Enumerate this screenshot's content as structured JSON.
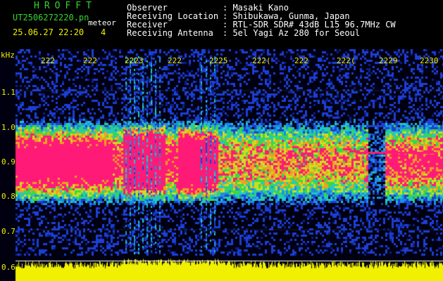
{
  "app": {
    "title": "HROFFT"
  },
  "file": {
    "name": "UT2506272220.pn",
    "category": "meteor"
  },
  "timestamp": {
    "text": "25.06.27 22:20",
    "count": "4"
  },
  "fields": [
    {
      "label": "Observer",
      "value": ": Masaki Kano"
    },
    {
      "label": "Receiving Location",
      "value": ": Shibukawa, Gunma, Japan"
    },
    {
      "label": "Receiver",
      "value": ": RTL-SDR SDR# 43dB L15 96.7MHz CW"
    },
    {
      "label": "Receiving Antenna",
      "value": ": 5el Yagi Az 280 for Seoul"
    }
  ],
  "axis": {
    "unit": "kHz",
    "frequency_ticks": [
      "1.1",
      "1.0",
      "0.9",
      "0.8",
      "0.7",
      "0.6"
    ],
    "time_ticks": [
      "222",
      "222",
      "2223",
      "222",
      "2225",
      "222(",
      "222",
      "222(",
      "2229",
      "2230"
    ]
  },
  "colors": {
    "background": "#000000",
    "header_green": "#33d633",
    "axis_yellow": "#f0f000",
    "signal_magenta": "#ff1a78",
    "noise_blue": "#0a1f8c"
  }
}
